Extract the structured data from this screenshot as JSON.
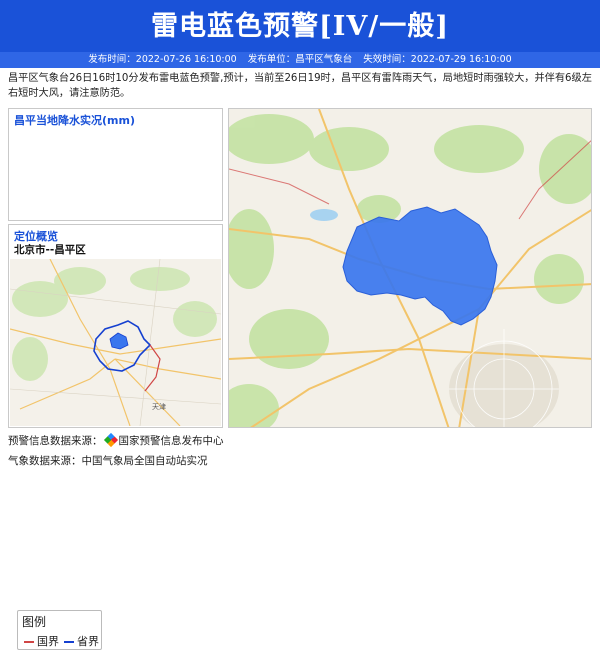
{
  "header": {
    "title": "雷电蓝色预警[IV/一般]",
    "issue_time": "发布时间：2022-07-26 16:10:00",
    "issuer": "发布单位：昌平区气象台",
    "expire_time": "失效时间：2022-07-29 16:10:00"
  },
  "description": "昌平区气象台26日16时10分发布雷电蓝色预警,预计，当前至26日19时，昌平区有雷阵雨天气，局地短时雨强较大，并伴有6级左右短时大风，请注意防范。",
  "rain_panel": {
    "title": "昌平当地降水实况(mm)"
  },
  "location_panel": {
    "title": "定位概览",
    "subtitle": "北京市--昌平区",
    "legend": {
      "title": "图例",
      "items": [
        "国界",
        "省界"
      ]
    },
    "map_labels": {
      "city": "天津"
    }
  },
  "footer": {
    "warning_source_prefix": "预警信息数据来源：",
    "warning_source": "国家预警信息发布中心",
    "weather_source": "气象数据来源：中国气象局全国自动站实况"
  },
  "colors": {
    "header": "#1a52d8",
    "district_fill": "#3a76ee",
    "boundary_red": "#d04545",
    "boundary_blue": "#1540d0"
  }
}
